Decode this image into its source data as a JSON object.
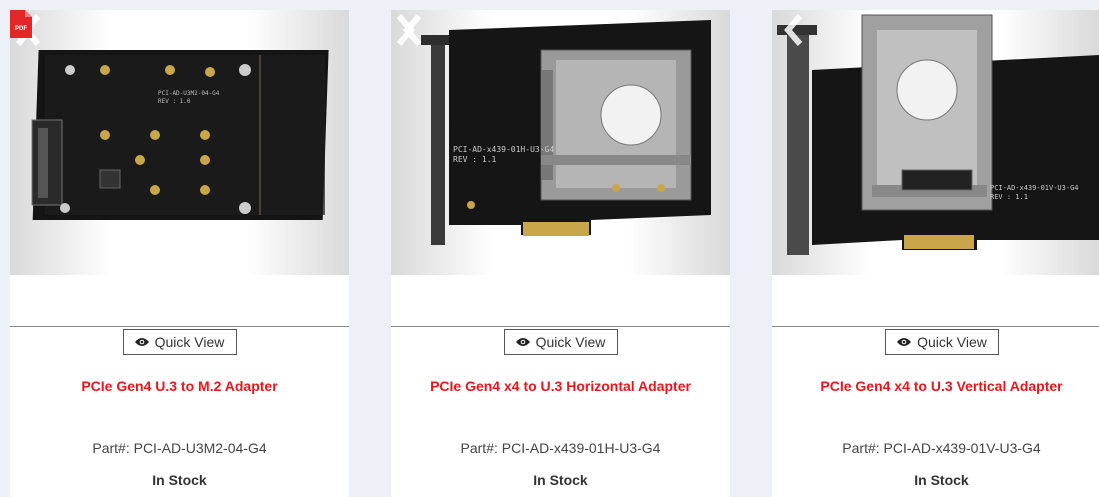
{
  "quick_view_label": "Quick View",
  "products": [
    {
      "title": "PCIe Gen4 U.3 to M.2 Adapter",
      "part": "Part#: PCI-AD-U3M2-04-G4",
      "stock": "In Stock",
      "has_pdf": true,
      "pdf_label": "PDF"
    },
    {
      "title": "PCIe Gen4 x4 to U.3 Horizontal Adapter",
      "part": "Part#: PCI-AD-x439-01H-U3-G4",
      "stock": "In Stock",
      "has_pdf": false
    },
    {
      "title": "PCIe Gen4 x4 to U.3 Vertical Adapter",
      "part": "Part#: PCI-AD-x439-01V-U3-G4",
      "stock": "In Stock",
      "has_pdf": false
    }
  ],
  "colors": {
    "title_red": "#e8171d",
    "pdf_red": "#e3262a",
    "page_bg": "#eef0f8"
  }
}
